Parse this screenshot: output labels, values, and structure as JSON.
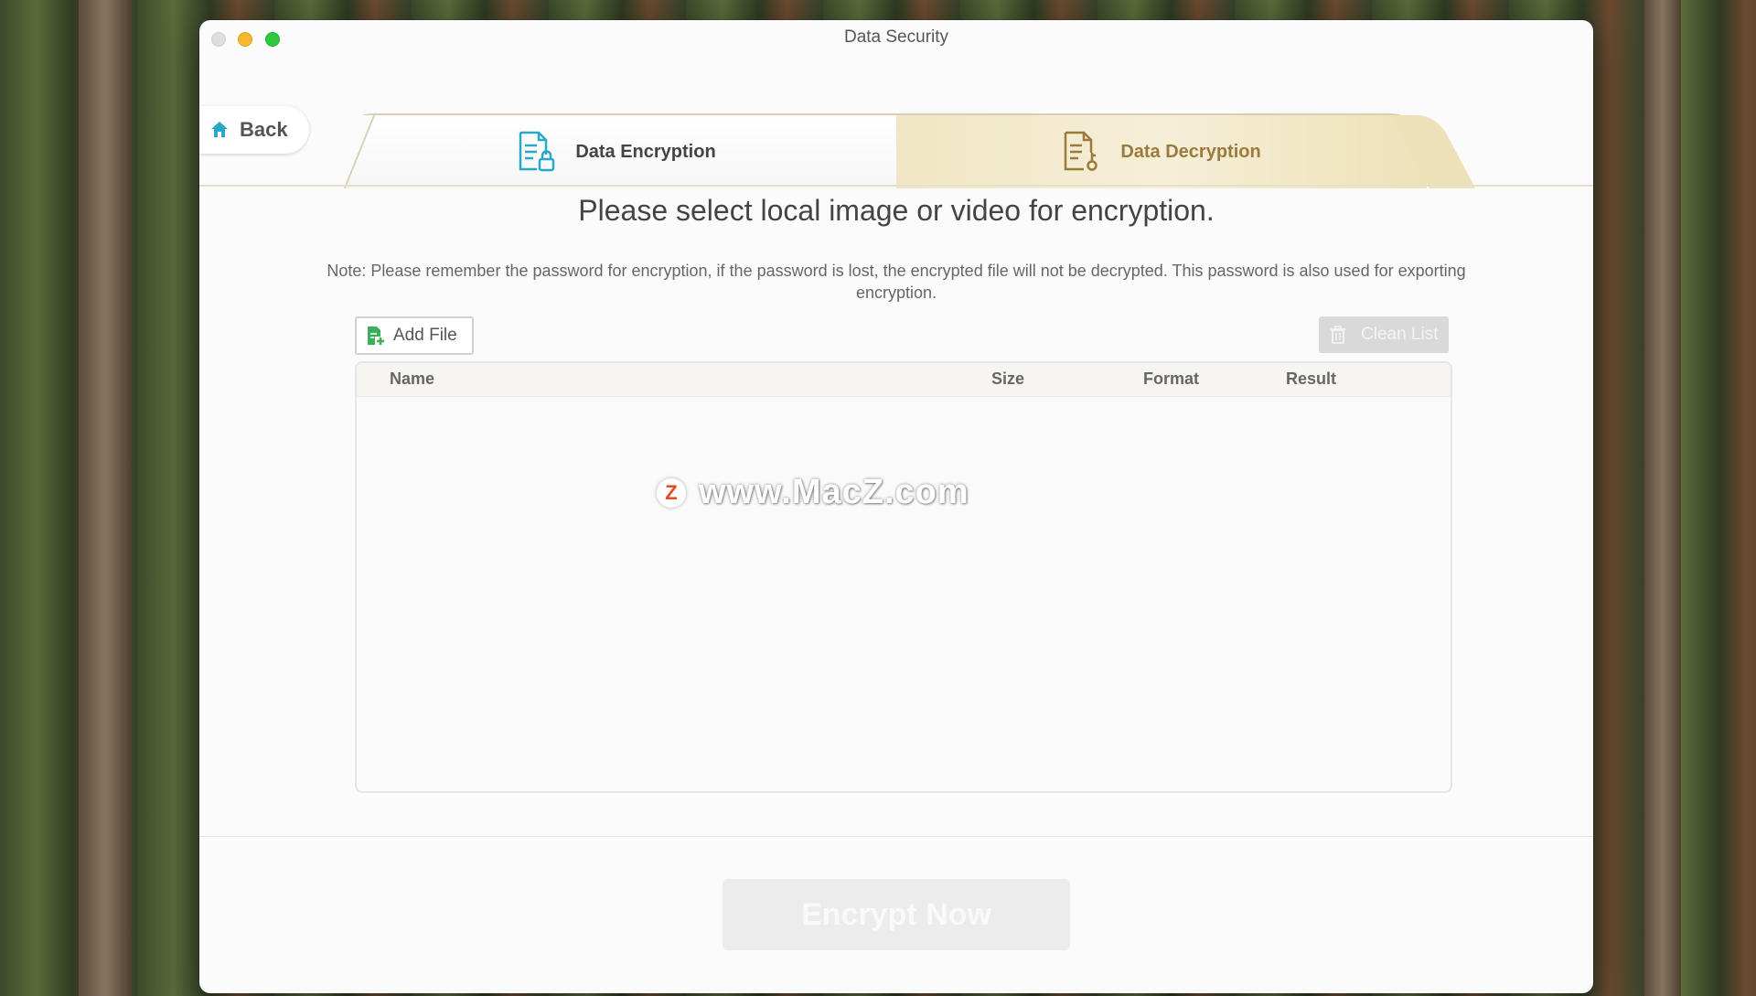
{
  "window": {
    "title": "Data Security"
  },
  "nav": {
    "back_label": "Back"
  },
  "tabs": [
    {
      "label": "Data Encryption",
      "icon": "document-lock-icon",
      "active": true
    },
    {
      "label": "Data Decryption",
      "icon": "document-key-icon",
      "active": false
    }
  ],
  "main": {
    "heading": "Please select local image or video for encryption.",
    "note": "Note: Please remember the password for encryption, if the password is lost, the encrypted file will not be decrypted. This password is also used for exporting encryption."
  },
  "toolbar": {
    "add_file_label": "Add File",
    "clean_list_label": "Clean List"
  },
  "table": {
    "columns": [
      "Name",
      "Size",
      "Format",
      "Result"
    ],
    "rows": []
  },
  "watermark": {
    "badge": "Z",
    "text": "www.MacZ.com"
  },
  "footer": {
    "encrypt_label": "Encrypt Now"
  },
  "colors": {
    "accent_teal": "#2ba7c9",
    "gold": "#9b7a3c",
    "green": "#3cae5c"
  }
}
